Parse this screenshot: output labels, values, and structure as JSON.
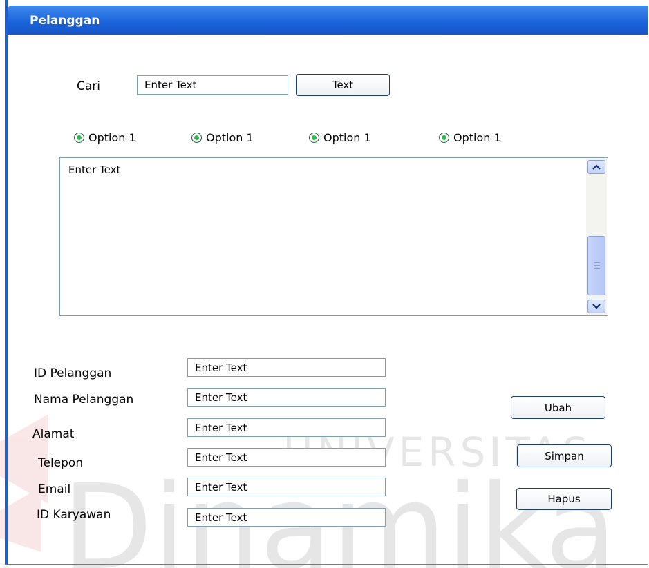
{
  "window": {
    "title": "Pelanggan"
  },
  "search": {
    "label": "Cari",
    "value": "Enter Text",
    "button_label": "Text"
  },
  "options": [
    {
      "label": "Option 1",
      "selected": true
    },
    {
      "label": "Option 1",
      "selected": true
    },
    {
      "label": "Option 1",
      "selected": true
    },
    {
      "label": "Option 1",
      "selected": true
    }
  ],
  "results": {
    "value": "Enter Text"
  },
  "form": {
    "fields": [
      {
        "label": "ID Pelanggan",
        "value": "Enter Text"
      },
      {
        "label": "Nama Pelanggan",
        "value": "Enter Text"
      },
      {
        "label": "Alamat",
        "value": "Enter Text"
      },
      {
        "label": "Telepon",
        "value": "Enter Text"
      },
      {
        "label": "Email",
        "value": "Enter Text"
      },
      {
        "label": "ID Karyawan",
        "value": "Enter Text"
      }
    ]
  },
  "actions": {
    "edit_label": "Ubah",
    "save_label": "Simpan",
    "delete_label": "Hapus"
  },
  "watermark": {
    "line1": "UNIVERSITAS",
    "line2": "Dinamika"
  },
  "colors": {
    "titlebar": "#1a62d9",
    "accent": "#1f5fd6",
    "radio": "#2eb84b",
    "watermark_red": "#d9454a"
  }
}
